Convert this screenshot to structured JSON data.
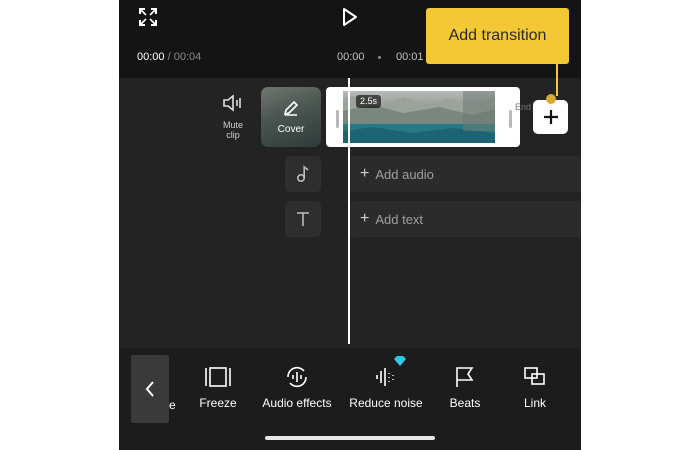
{
  "header": {
    "current_time": "00:00",
    "total_time": "/ 00:04"
  },
  "ruler": {
    "labels": [
      "00:00",
      "00:01"
    ]
  },
  "timeline": {
    "mute_label": "Mute\nclip",
    "cover_label": "Cover",
    "clip_duration": "2.5s",
    "end_label": "End",
    "add_audio_label": "Add audio",
    "add_text_label": "Add text"
  },
  "tooltip": {
    "text": "Add transition"
  },
  "toolbar": {
    "peek_label": "e",
    "tools": [
      {
        "label": "Freeze",
        "icon": "freeze-icon"
      },
      {
        "label": "Audio effects",
        "icon": "audio-effects-icon"
      },
      {
        "label": "Reduce noise",
        "icon": "reduce-noise-icon"
      },
      {
        "label": "Beats",
        "icon": "beats-icon"
      },
      {
        "label": "Link",
        "icon": "link-icon"
      }
    ]
  },
  "colors": {
    "tooltip": "#f3c735",
    "background": "#222222",
    "premium_badge": "#2ec8e6"
  }
}
